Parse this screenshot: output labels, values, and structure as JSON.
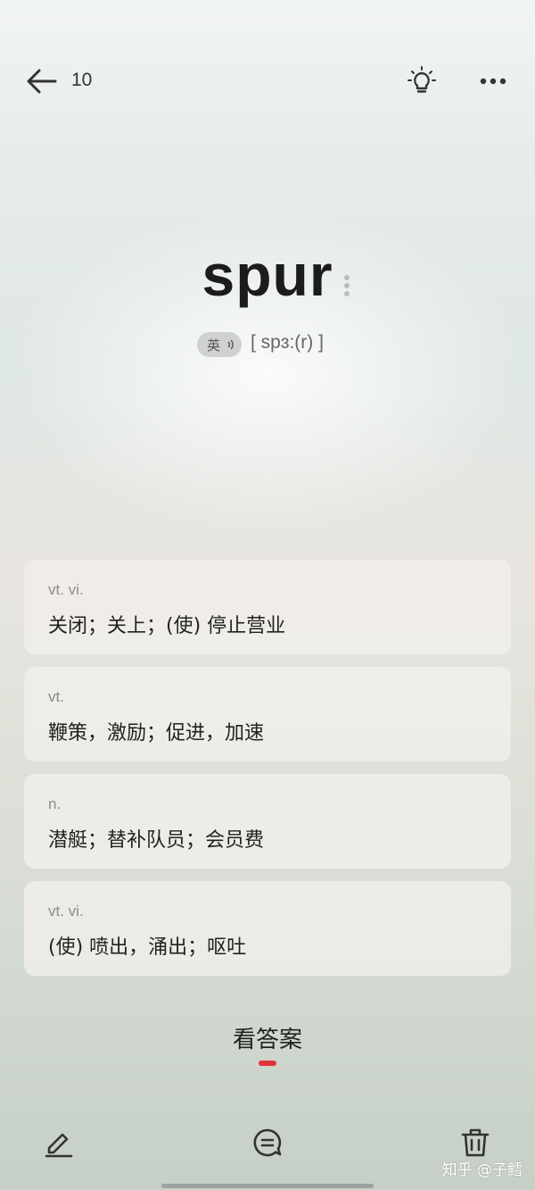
{
  "header": {
    "count": "10",
    "back_icon": "arrow-left-icon",
    "hint_icon": "lightbulb-icon",
    "more_icon": "more-dots-icon"
  },
  "word": {
    "text": "spur",
    "accent_label": "英",
    "audio_icon": "speaker-icon",
    "phonetic": "[ spɜ:(r) ]"
  },
  "definitions": [
    {
      "pos": "vt.  vi.",
      "meaning": "关闭；关上；(使) 停止营业"
    },
    {
      "pos": "vt.",
      "meaning": "鞭策，激励；促进，加速"
    },
    {
      "pos": "n.",
      "meaning": "潜艇；替补队员；会员费"
    },
    {
      "pos": "vt.  vi.",
      "meaning": "(使) 喷出，涌出；呕吐"
    }
  ],
  "answer_label": "看答案",
  "bottom_bar": {
    "edit_icon": "pencil-icon",
    "note_icon": "comment-icon",
    "delete_icon": "trash-icon"
  },
  "watermark": "知乎 @子鳕",
  "colors": {
    "accent": "#e0333c",
    "text": "#222222",
    "muted": "#8c8c8c"
  }
}
